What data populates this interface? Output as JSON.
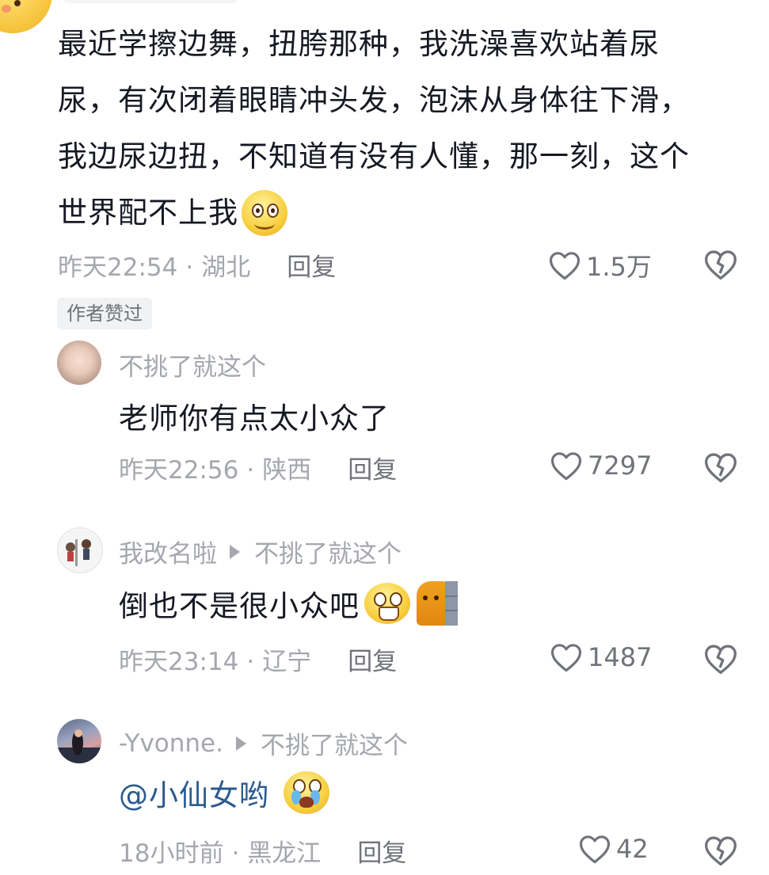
{
  "main_comment": {
    "lines": [
      "最近学擦边舞，扭胯那种，我洗澡喜欢站着尿",
      "尿，有次闭着眼睛冲头发，泡沫从身体往下滑，",
      "我边尿边扭，不知道有没有人懂，那一刻，这个",
      "世界配不上我"
    ],
    "emoji": "smile-emoji",
    "time": "昨天22:54",
    "location": "湖北",
    "reply_label": "回复",
    "likes": "1.5万",
    "author_tag": "作者赞过"
  },
  "replies": [
    {
      "username": "不挑了就这个",
      "reply_to": "",
      "text": "老师你有点太小众了",
      "time": "昨天22:56",
      "location": "陕西",
      "reply_label": "回复",
      "likes": "7297",
      "avatar": "baby-photo-avatar"
    },
    {
      "username": "我改名啦",
      "reply_to": "不挑了就这个",
      "text": "倒也不是很小众吧",
      "emojis": [
        "grin-emoji",
        "cat-peek-emoji"
      ],
      "time": "昨天23:14",
      "location": "辽宁",
      "reply_label": "回复",
      "likes": "1487",
      "avatar": "cartoon-kids-avatar"
    },
    {
      "username": "-Yvonne.",
      "reply_to": "不挑了就这个",
      "mention": "@小仙女哟",
      "emojis": [
        "crying-emoji"
      ],
      "time": "18小时前",
      "location": "黑龙江",
      "reply_label": "回复",
      "likes": "42",
      "avatar": "girl-photo-avatar"
    }
  ],
  "colors": {
    "text": "#161823",
    "meta": "#a4a7ad",
    "mention": "#2b5a8f",
    "tag_bg": "#f1f2f3"
  }
}
